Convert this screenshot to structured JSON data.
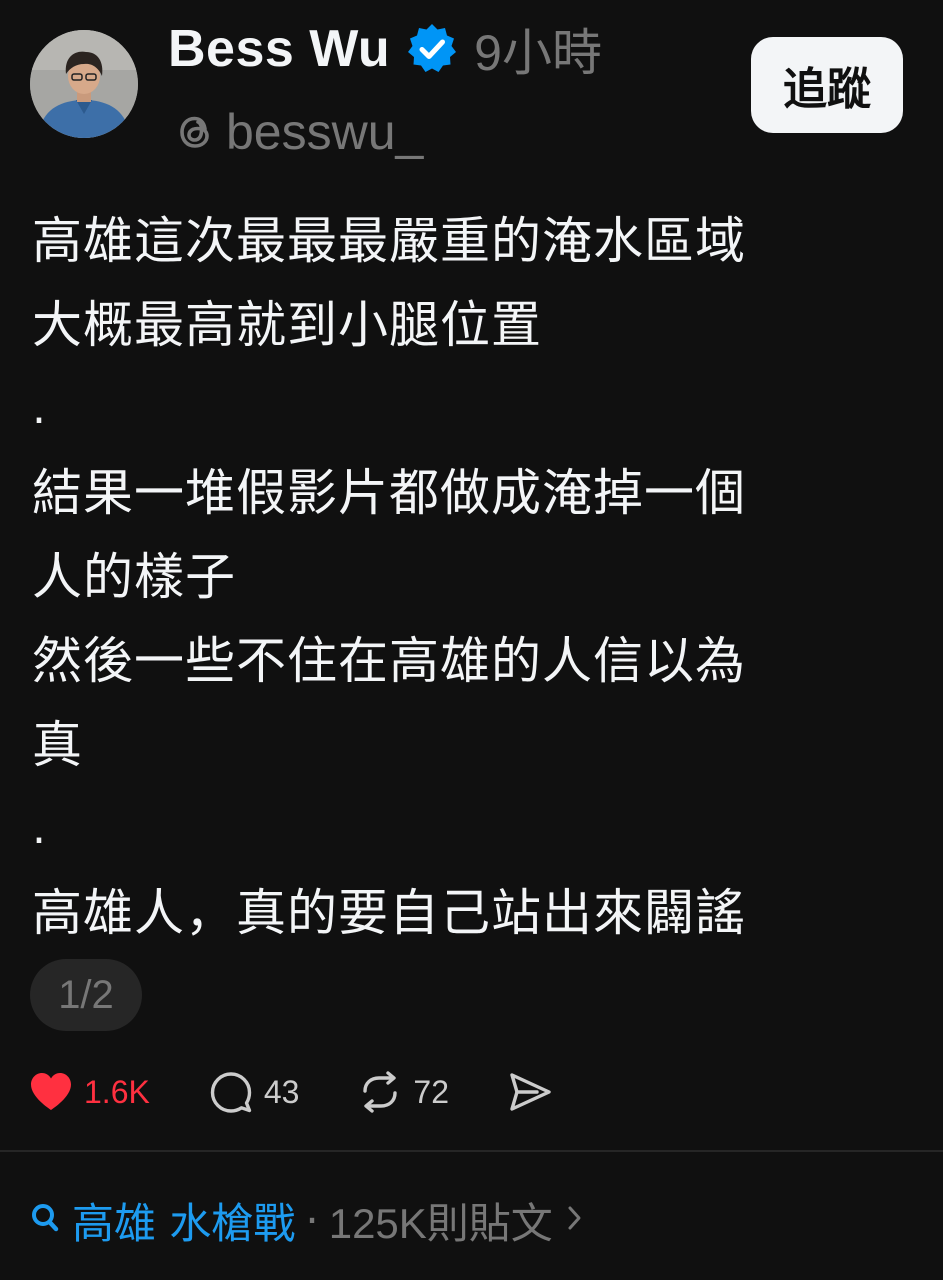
{
  "post": {
    "author": {
      "display_name": "Bess Wu",
      "handle": "besswu_",
      "verified": true,
      "avatar_icon": "avatar-photo"
    },
    "time_ago": "9小時",
    "follow_label": "追蹤",
    "lines": [
      "高雄這次最最最嚴重的淹水區域",
      "大概最高就到小腿位置",
      ".",
      "結果一堆假影片都做成淹掉一個",
      "人的樣子",
      "然後一些不住在高雄的人信以為",
      "真",
      ".",
      "高雄人，真的要自己站出來闢謠"
    ],
    "page_indicator": "1/2",
    "actions": {
      "likes": "1.6K",
      "comments": "43",
      "reposts": "72"
    }
  },
  "topic": {
    "name": "高雄 水槍戰",
    "separator": "·",
    "count": "125K則貼文"
  },
  "colors": {
    "background": "#101010",
    "primary_text": "#f3f5f7",
    "secondary_text": "#777777",
    "like_red": "#ff3040",
    "verified_blue": "#0095f6",
    "topic_blue": "#1d9bf0"
  }
}
